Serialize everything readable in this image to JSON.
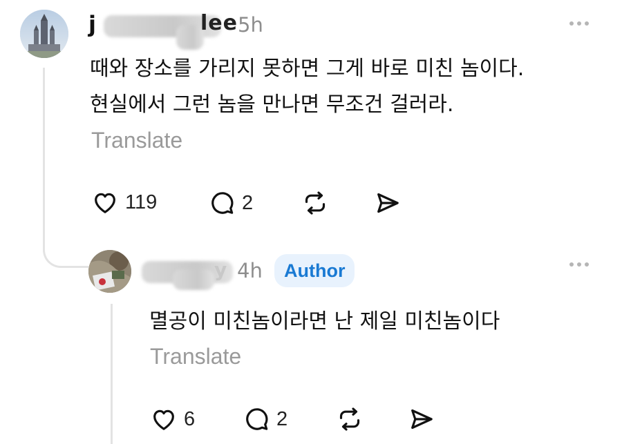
{
  "comments": [
    {
      "username": "j",
      "username_tail": "lee",
      "time": "5h",
      "text_lines": [
        "때와 장소를 가리지 못하면 그게 바로 미친 놈이다.",
        "현실에서 그런 놈을 만나면 무조건 걸러라."
      ],
      "translate_label": "Translate",
      "likes": "119",
      "replies": "2"
    },
    {
      "username_tail": "y",
      "time": "4h",
      "badge": "Author",
      "text_lines": [
        "멸공이 미친놈이라면 난 제일 미친놈이다"
      ],
      "translate_label": "Translate",
      "likes": "6",
      "replies": "2"
    }
  ],
  "colors": {
    "badge_bg": "#e8f2fd",
    "badge_text": "#1a7ad3",
    "muted": "#8e8e8e",
    "thread_line": "#e3e3e3"
  },
  "icons": [
    "heart-icon",
    "comment-icon",
    "repost-icon",
    "share-icon",
    "more-icon"
  ]
}
